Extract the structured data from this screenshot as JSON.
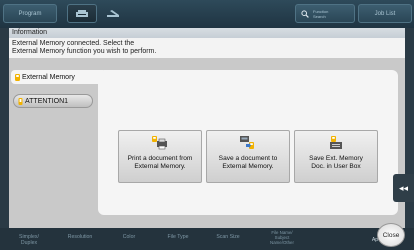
{
  "topbar": {
    "program": "Program",
    "function_line1": "Function",
    "function_line2": "Search",
    "job_list": "Job List"
  },
  "info": {
    "title": "Information",
    "message_line1": "External Memory connected. Select the",
    "message_line2": "External Memory function you wish to perform."
  },
  "tabs": [
    {
      "label": "External Memory",
      "icon": "external-memory-icon"
    },
    {
      "label": "ATTENTION1",
      "icon": "attention-icon"
    }
  ],
  "actions": [
    {
      "line1": "Print a document from",
      "line2": "External Memory.",
      "icon": "print-from-memory-icon"
    },
    {
      "line1": "Save a document to",
      "line2": "External Memory.",
      "icon": "save-to-memory-icon"
    },
    {
      "line1": "Save Ext. Memory",
      "line2": "Doc. in User Box",
      "icon": "save-to-user-box-icon"
    }
  ],
  "side_tab": "◂◂",
  "bottombar": {
    "simplex_line1": "Simplex/",
    "simplex_line2": "Duplex",
    "resolution": "Resolution",
    "color": "Color",
    "file_type": "File Type",
    "scan_size": "Scan Size",
    "file_name_line1": "File Name/",
    "file_name_line2": "Subject",
    "file_name_line3": "Name/Other",
    "ap": "Ap"
  },
  "close": "Close",
  "colors": {
    "accent": "#f2b200",
    "background": "#2a3a45"
  }
}
